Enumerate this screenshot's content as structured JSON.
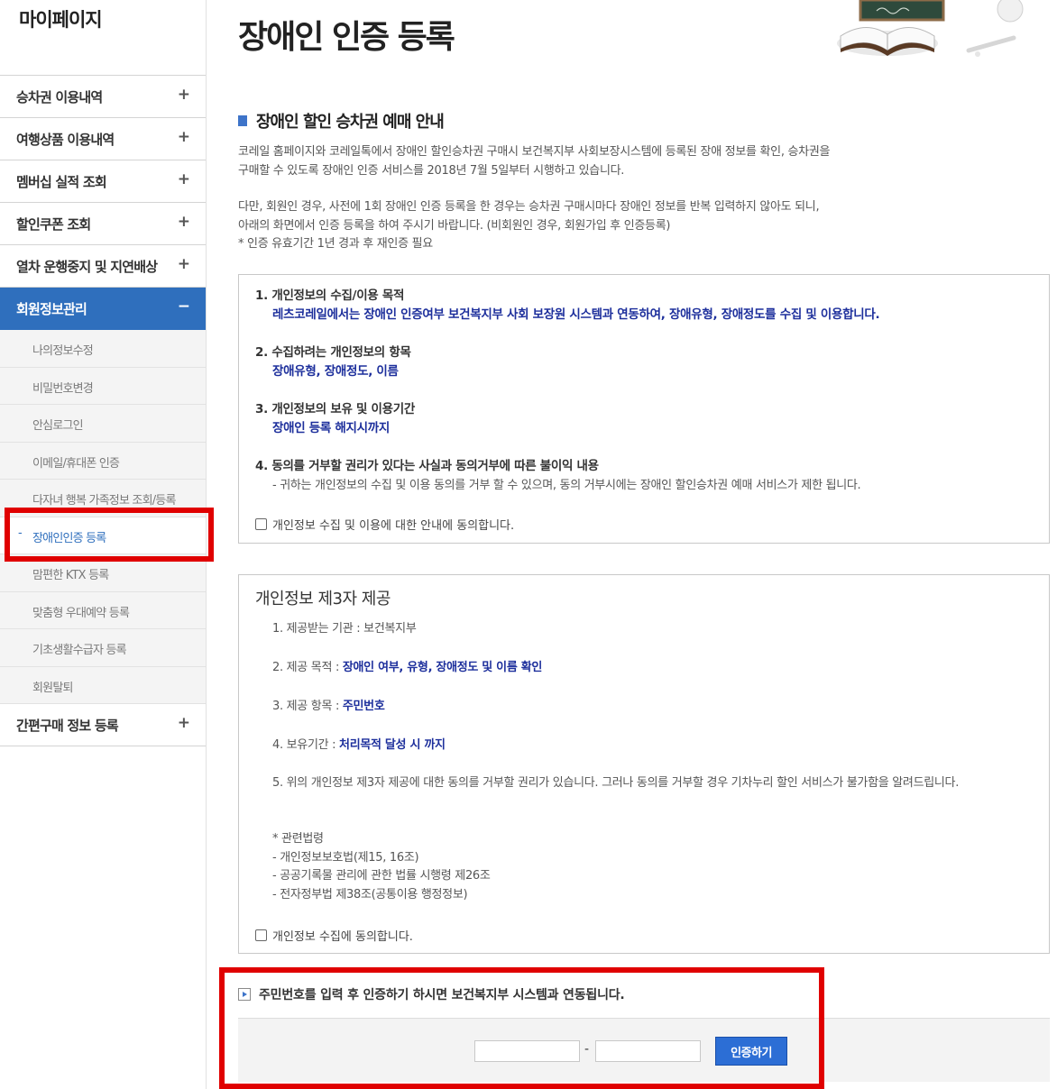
{
  "sidebar": {
    "title": "마이페이지",
    "items": [
      {
        "label": "승차권 이용내역",
        "toggle": "+"
      },
      {
        "label": "여행상품 이용내역",
        "toggle": "+"
      },
      {
        "label": "멤버십 실적 조회",
        "toggle": "+"
      },
      {
        "label": "할인쿠폰 조회",
        "toggle": "+"
      },
      {
        "label": "열차 운행중지 및 지연배상",
        "toggle": "+"
      },
      {
        "label": "회원정보관리",
        "toggle": "−"
      },
      {
        "label": "간편구매 정보 등록",
        "toggle": "+"
      }
    ],
    "subitems": [
      {
        "label": "나의정보수정"
      },
      {
        "label": "비밀번호변경"
      },
      {
        "label": "안심로그인"
      },
      {
        "label": "이메일/휴대폰 인증"
      },
      {
        "label": "다자녀 행복 가족정보 조회/등록"
      },
      {
        "label": "장애인인증 등록",
        "marker": "-"
      },
      {
        "label": "맘편한 KTX 등록"
      },
      {
        "label": "맞춤형 우대예약 등록"
      },
      {
        "label": "기초생활수급자 등록"
      },
      {
        "label": "회원탈퇴"
      }
    ]
  },
  "page": {
    "title": "장애인 인증 등록",
    "section_title": "장애인 할인 승차권 예매 안내",
    "intro": [
      "코레일 홈페이지와 코레일톡에서 장애인 할인승차권 구매시 보건복지부 사회보장시스템에 등록된 장애 정보를 확인, 승차권을",
      "구매할 수 있도록 장애인 인증 서비스를 2018년 7월 5일부터 시행하고 있습니다.",
      "다만, 회원인 경우, 사전에 1회 장애인 인증 등록을 한 경우는 승차권 구매시마다 장애인 정보를 반복 입력하지 않아도 되니,",
      "아래의 화면에서 인증 등록을 하여 주시기 바랍니다. (비회원인 경우, 회원가입 후 인증등록)",
      "* 인증 유효기간 1년 경과 후 재인증 필요"
    ]
  },
  "consent1": {
    "items": [
      {
        "head": "1. 개인정보의 수집/이용 목적",
        "detail": "레츠코레일에서는 장애인 인증여부 보건복지부 사회 보장원 시스템과 연동하여, 장애유형, 장애정도를 수집 및 이용합니다."
      },
      {
        "head": "2. 수집하려는 개인정보의 항목",
        "detail": "장애유형, 장애정도, 이름"
      },
      {
        "head": "3. 개인정보의 보유 및 이용기간",
        "detail": "장애인 등록 해지시까지"
      },
      {
        "head": "4. 동의를 거부할 권리가 있다는 사실과 동의거부에 따른 불이익 내용",
        "note": "- 귀하는 개인정보의 수집 및 이용 동의를 거부 할 수 있으며, 동의 거부시에는 장애인 할인승차권 예매 서비스가 제한 됩니다."
      }
    ],
    "checkbox_label": "개인정보 수집 및 이용에 대한 안내에 동의합니다."
  },
  "consent2": {
    "title": "개인정보 제3자 제공",
    "item1": "1. 제공받는 기관 : 보건복지부",
    "item2_label": "2. 제공 목적 : ",
    "item2_value": "장애인 여부, 유형, 장애정도 및 이름 확인",
    "item3_label": "3. 제공 항목 : ",
    "item3_value": "주민번호",
    "item4_label": "4. 보유기간 : ",
    "item4_value": "처리목적 달성 시 까지",
    "item5": "5. 위의 개인정보 제3자 제공에 대한 동의를 거부할 권리가 있습니다. 그러나 동의를 거부할 경우 기차누리 할인 서비스가 불가함을 알려드립니다.",
    "laws": [
      "* 관련법령",
      "- 개인정보보호법(제15, 16조)",
      "- 공공기록물 관리에 관한 법률 시행령 제26조",
      "- 전자정부법 제38조(공통이용 행정정보)"
    ],
    "checkbox_label": "개인정보 수집에 동의합니다."
  },
  "auth": {
    "notice": "주민번호를 입력 후 인증하기 하시면 보건복지부 시스템과 연동됩니다.",
    "dash": "-",
    "rrn_front": "",
    "rrn_back": "",
    "button": "인증하기"
  },
  "colors": {
    "accent": "#2f6fbd",
    "highlight_text": "#1d2f9c",
    "annotation_red": "#e00000",
    "button": "#2c6ed5"
  }
}
